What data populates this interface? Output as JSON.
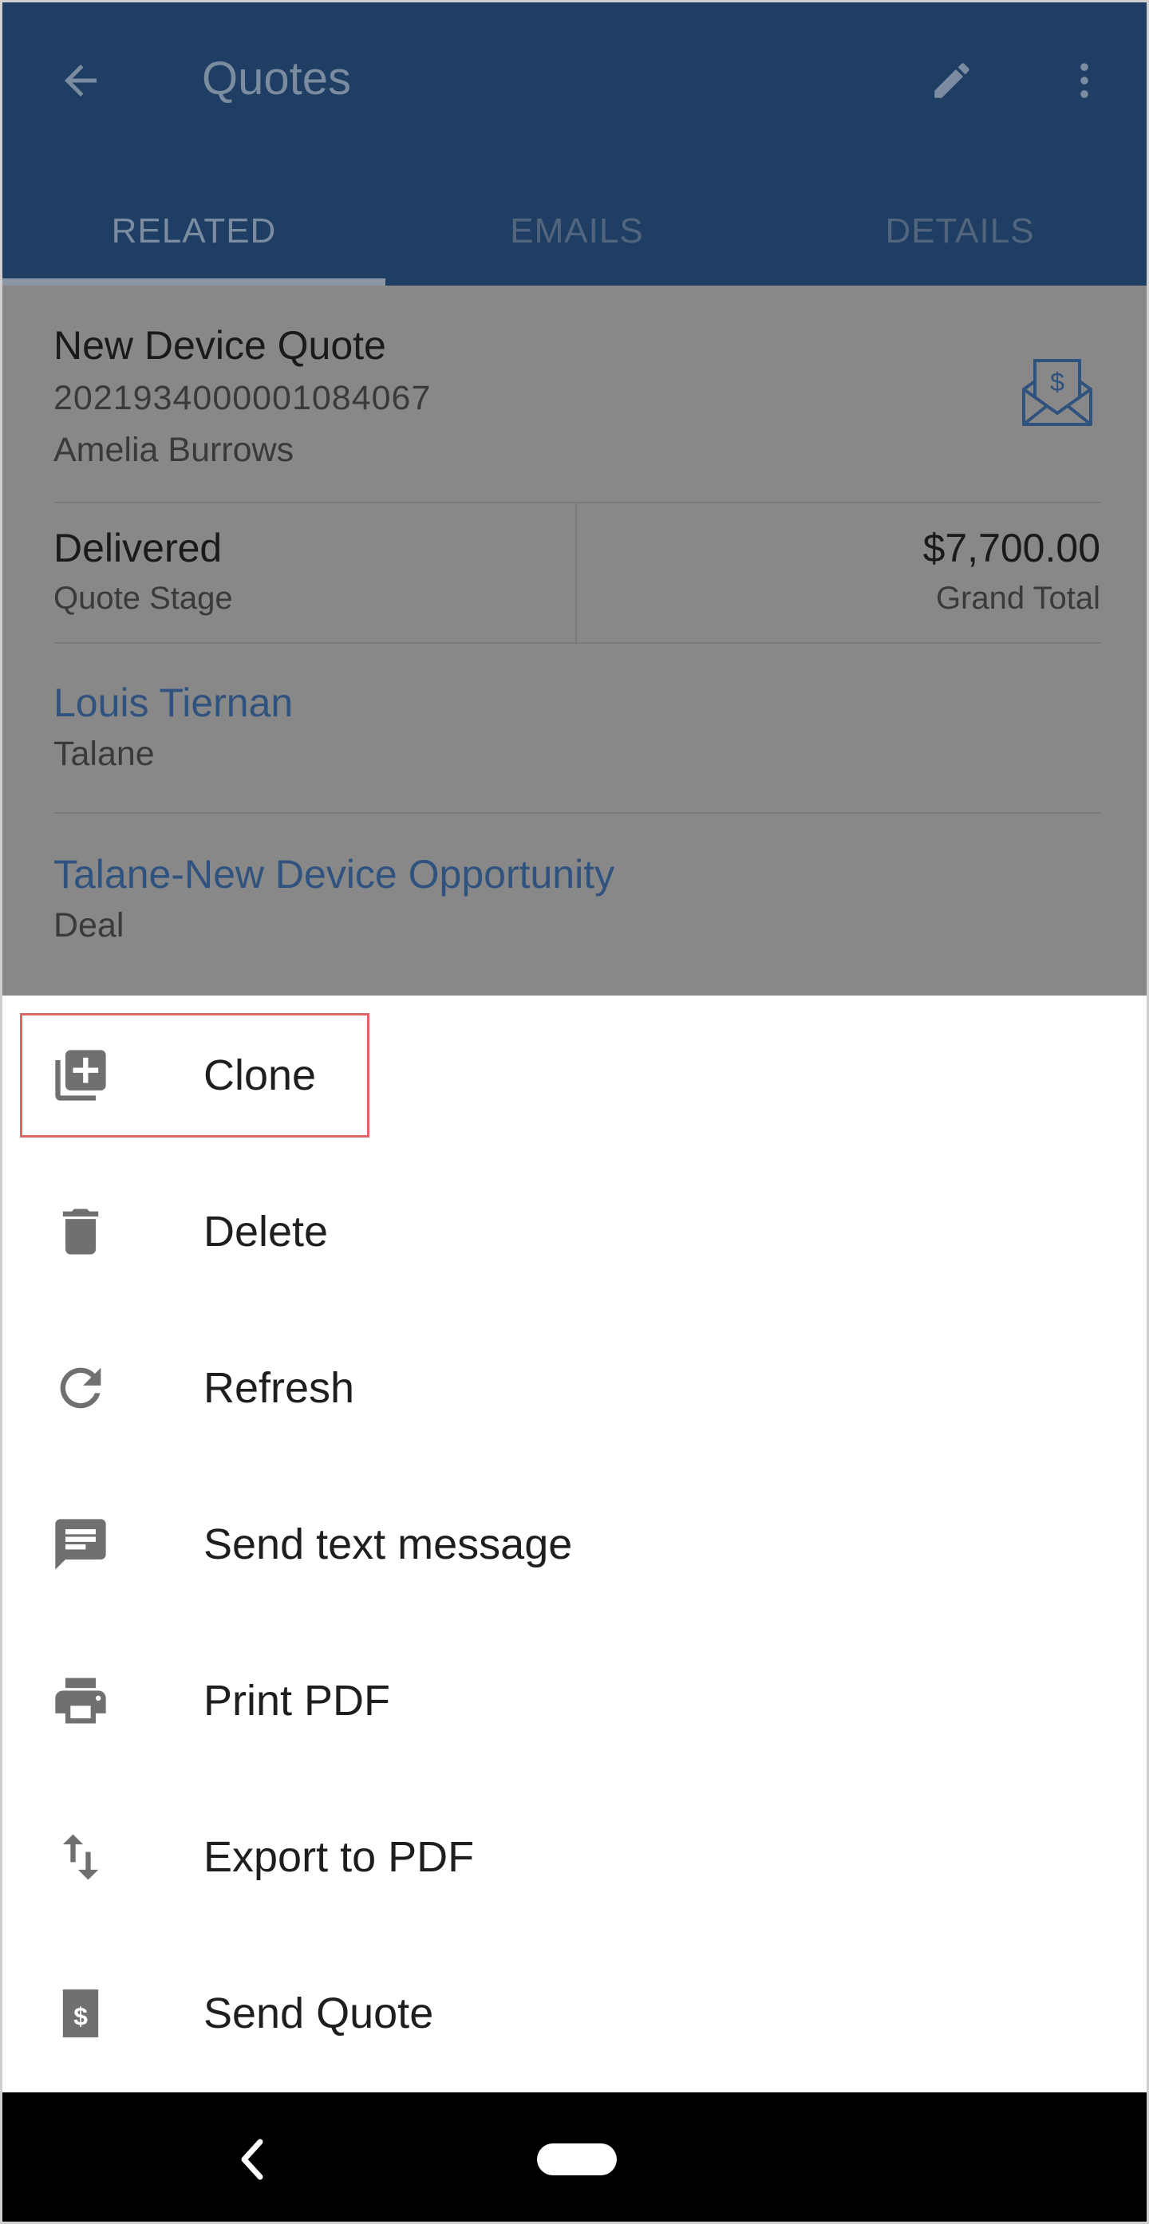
{
  "app_bar": {
    "title": "Quotes"
  },
  "tabs": [
    {
      "label": "RELATED",
      "active": true
    },
    {
      "label": "EMAILS",
      "active": false
    },
    {
      "label": "DETAILS",
      "active": false
    }
  ],
  "record": {
    "name": "New Device Quote",
    "number": "2021934000001084067",
    "owner": "Amelia Burrows",
    "stage_value": "Delivered",
    "stage_label": "Quote Stage",
    "total_value": "$7,700.00",
    "total_label": "Grand Total",
    "contact_name": "Louis Tiernan",
    "contact_account": "Talane",
    "deal_name": "Talane-New Device Opportunity",
    "deal_label": "Deal"
  },
  "menu": {
    "items": [
      {
        "label": "Clone",
        "icon": "clone-icon"
      },
      {
        "label": "Delete",
        "icon": "trash-icon"
      },
      {
        "label": "Refresh",
        "icon": "refresh-icon"
      },
      {
        "label": "Send text message",
        "icon": "message-icon"
      },
      {
        "label": "Print PDF",
        "icon": "printer-icon"
      },
      {
        "label": "Export to PDF",
        "icon": "swap-vertical-icon"
      },
      {
        "label": "Send Quote",
        "icon": "dollar-document-icon"
      }
    ]
  },
  "colors": {
    "app_bar": "#1f3e63",
    "scrim_content": "#888888",
    "link": "#2f527f",
    "icon": "#707070",
    "highlight": "#e06666"
  }
}
